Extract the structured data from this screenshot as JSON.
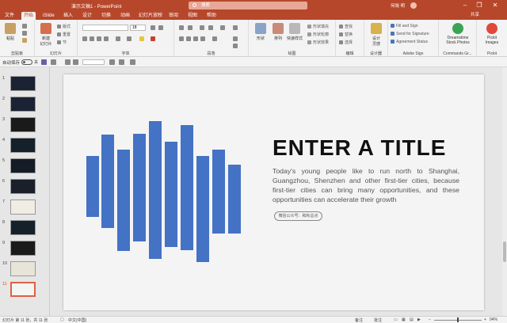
{
  "titlebar": {
    "doc_title": "演示文稿1 - PowerPoint",
    "search_placeholder": "搜索",
    "user_name": "何晓 明",
    "minimize": "–",
    "restore": "❐",
    "close": "✕"
  },
  "menu": {
    "tabs": [
      {
        "label": "文件"
      },
      {
        "label": "开始"
      },
      {
        "label": "iSlide"
      },
      {
        "label": "插入"
      },
      {
        "label": "设计"
      },
      {
        "label": "切换"
      },
      {
        "label": "动画"
      },
      {
        "label": "幻灯片放映"
      },
      {
        "label": "审阅"
      },
      {
        "label": "视图"
      },
      {
        "label": "帮助"
      }
    ],
    "share": "共享"
  },
  "ribbon": {
    "clipboard": {
      "paste": "粘贴",
      "label": "剪贴板"
    },
    "slides": {
      "new_slide": "新建\n幻灯片",
      "layout": "版式",
      "reset": "重置",
      "section": "节",
      "label": "幻灯片"
    },
    "font": {
      "size": "18",
      "label": "字体"
    },
    "paragraph": {
      "label": "段落"
    },
    "drawing": {
      "shapes": "形状",
      "arrange": "排列",
      "quick_styles": "快速样式",
      "fill": "形状填充",
      "outline": "形状轮廓",
      "effects": "形状效果",
      "label": "绘图"
    },
    "editing": {
      "find": "查找",
      "replace": "替换",
      "select": "选择",
      "label": "编辑"
    },
    "designer": {
      "ideas": "设计\n灵感",
      "label": "设计器"
    },
    "adobe": {
      "fill_sign": "Fill and Sign",
      "send_sig": "Send for Signature",
      "agreement": "Agreement Status",
      "label": "Adobe Sign"
    },
    "dreamstime": {
      "stock": "Dreamstime\nStock Photos",
      "label": "Commands Gr..."
    },
    "pickit": {
      "images": "Pickit\nImages",
      "label": "Pickit"
    }
  },
  "qat": {
    "autosave": "自动保存",
    "off": "关"
  },
  "thumbnails": [
    {
      "num": "1"
    },
    {
      "num": "2"
    },
    {
      "num": "3"
    },
    {
      "num": "4"
    },
    {
      "num": "5"
    },
    {
      "num": "6"
    },
    {
      "num": "7"
    },
    {
      "num": "8"
    },
    {
      "num": "9"
    },
    {
      "num": "10"
    },
    {
      "num": "11"
    }
  ],
  "slide": {
    "title": "ENTER A TITLE",
    "body": "Today's young people like to run north to Shanghai, Guangzhou, Shenzhen and other first-tier cities, because first-tier cities can bring many opportunities, and these opportunities can accelerate their growth",
    "button": "微信公众号：和秋总点",
    "bar_color": "#4472c4"
  },
  "status": {
    "slide_count": "幻灯片 第 11 张，共 11 张",
    "lang": "中文(中国)",
    "notes": "备注",
    "comments": "批注",
    "zoom": "94%"
  }
}
